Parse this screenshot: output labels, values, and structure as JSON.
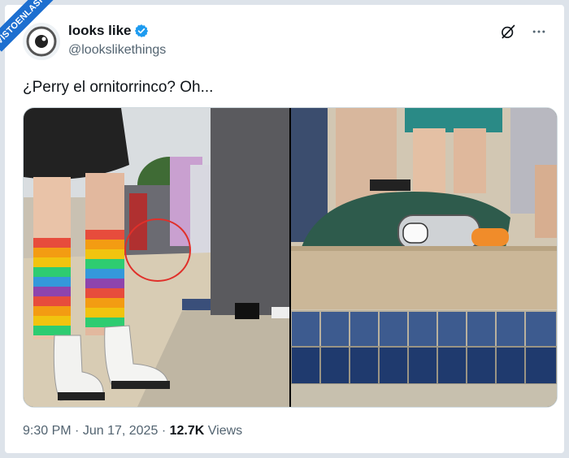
{
  "watermark": "VISTOENLASREDES .com",
  "author": {
    "display_name": "looks like",
    "handle": "@lookslikethings",
    "verified": true
  },
  "actions": {
    "grok_icon": "grok-icon",
    "more_icon": "more-icon"
  },
  "tweet": {
    "text": "¿Perry el ornitorrinco? Oh..."
  },
  "media": {
    "count": 2,
    "images": [
      {
        "kind": "photo"
      },
      {
        "kind": "photo"
      }
    ]
  },
  "meta": {
    "time": "9:30 PM",
    "date": "Jun 17, 2025",
    "views_count": "12.7K",
    "views_label": "Views",
    "separator": "·"
  },
  "colors": {
    "verified_blue": "#1d9bf0",
    "text_primary": "#0f1419",
    "text_secondary": "#536471"
  }
}
